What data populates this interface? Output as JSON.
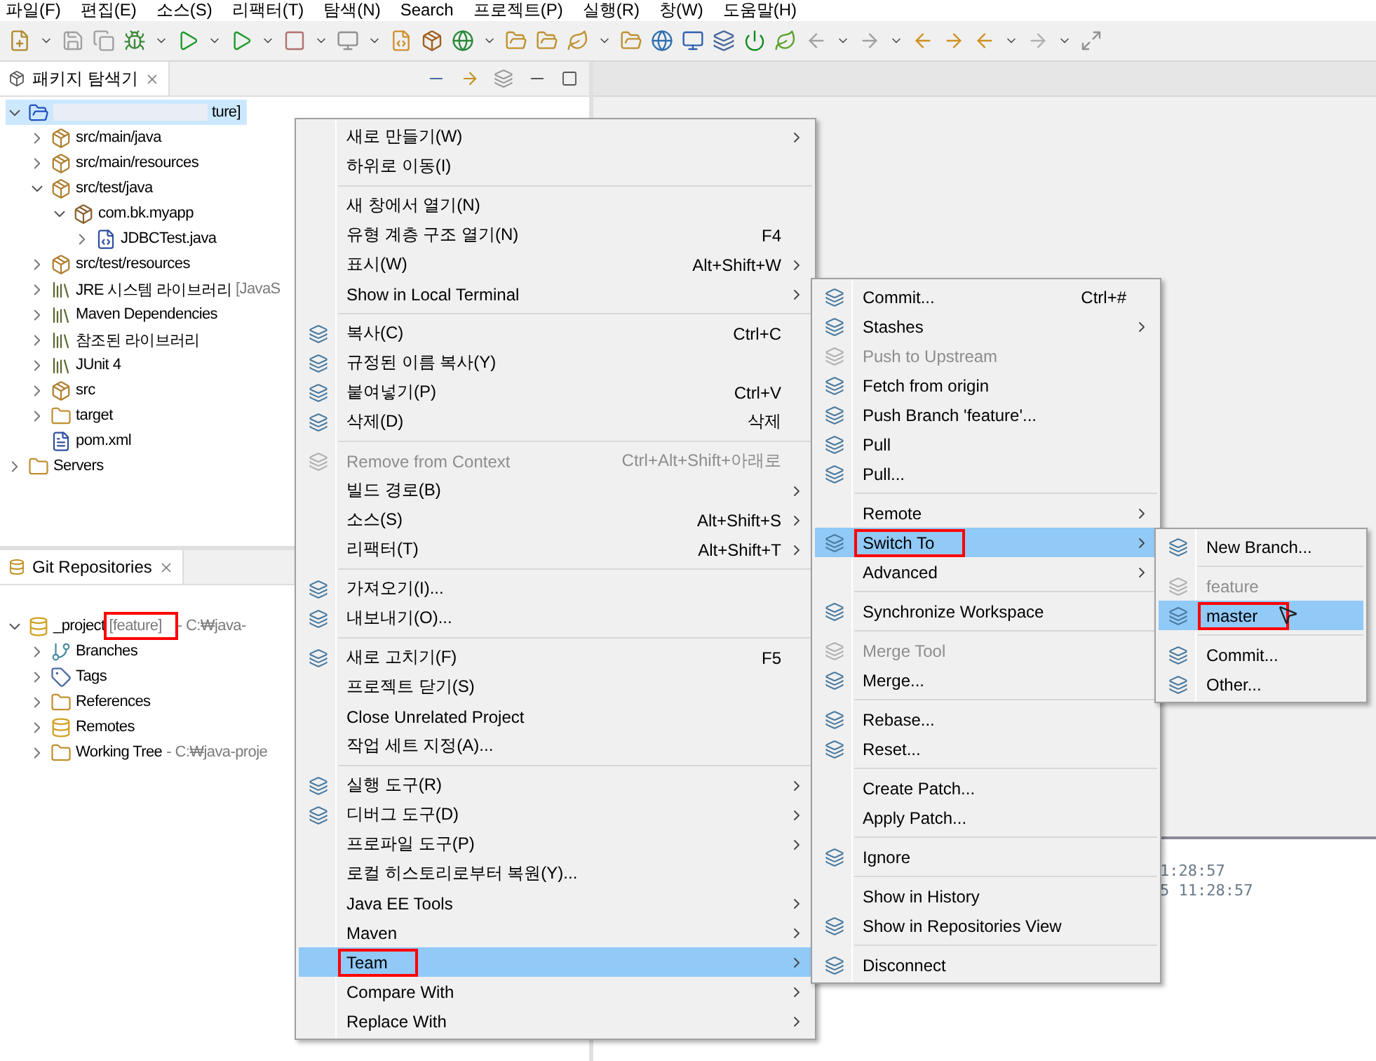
{
  "menu_bar": [
    "파일(F)",
    "편집(E)",
    "소스(S)",
    "리팩터(T)",
    "탐색(N)",
    "Search",
    "프로젝트(P)",
    "실행(R)",
    "창(W)",
    "도움말(H)"
  ],
  "package_explorer": {
    "title": "패키지 탐색기",
    "tree": [
      {
        "kind": "project",
        "label": "ture]",
        "redacted": true,
        "expanded": true,
        "selected": true,
        "children": [
          {
            "kind": "source-folder",
            "label": "src/main/java",
            "expanded": false,
            "selected": false
          },
          {
            "kind": "source-folder",
            "label": "src/main/resources",
            "expanded": false,
            "selected": false
          },
          {
            "kind": "source-folder",
            "label": "src/test/java",
            "expanded": true,
            "selected": false,
            "children": [
              {
                "kind": "package",
                "label": "com.bk.myapp",
                "expanded": true,
                "selected": false,
                "children": [
                  {
                    "kind": "java-file",
                    "label": "JDBCTest.java",
                    "expanded": false,
                    "selected": false
                  }
                ]
              }
            ]
          },
          {
            "kind": "source-folder",
            "label": "src/test/resources",
            "expanded": false,
            "selected": false
          },
          {
            "kind": "library",
            "label": "JRE 시스템 라이브러리",
            "decoration": "[JavaS",
            "expanded": false,
            "selected": false
          },
          {
            "kind": "library",
            "label": "Maven Dependencies",
            "expanded": false,
            "selected": false
          },
          {
            "kind": "library",
            "label": "참조된 라이브러리",
            "expanded": false,
            "selected": false
          },
          {
            "kind": "library",
            "label": "JUnit 4",
            "expanded": false,
            "selected": false
          },
          {
            "kind": "source-folder",
            "label": "src",
            "expanded": false,
            "selected": false
          },
          {
            "kind": "folder",
            "label": "target",
            "expanded": false,
            "selected": false
          },
          {
            "kind": "xml-file",
            "label": "pom.xml",
            "selected": false
          }
        ]
      },
      {
        "kind": "folder",
        "label": "Servers",
        "expanded": false,
        "selected": false
      }
    ]
  },
  "git_repositories": {
    "title": "Git Repositories",
    "tree": [
      {
        "kind": "repo",
        "label": "_project",
        "decoration": "[feature]",
        "decoration_annotated": true,
        "path": "- C:₩java-",
        "expanded": true,
        "selected": false,
        "children": [
          {
            "kind": "branches",
            "label": "Branches",
            "expanded": false,
            "selected": false
          },
          {
            "kind": "tags",
            "label": "Tags",
            "expanded": false,
            "selected": false
          },
          {
            "kind": "folder",
            "label": "References",
            "expanded": false,
            "selected": false
          },
          {
            "kind": "repo",
            "label": "Remotes",
            "expanded": false,
            "selected": false
          },
          {
            "kind": "folder",
            "label": "Working Tree",
            "path": "- C:₩java-proje",
            "expanded": false,
            "selected": false
          }
        ]
      }
    ]
  },
  "console": {
    "lines": [
      "1:28:57",
      "5 11:28:57"
    ]
  },
  "context_menu": [
    {
      "kind": "item",
      "label": "새로 만들기(W)",
      "submenu": true,
      "has_icon": false,
      "disabled": false,
      "selected": false,
      "annotated": false
    },
    {
      "kind": "item",
      "label": "하위로 이동(I)",
      "submenu": false,
      "has_icon": false,
      "disabled": false,
      "selected": false,
      "annotated": false
    },
    {
      "kind": "separator"
    },
    {
      "kind": "item",
      "label": "새 창에서 열기(N)",
      "submenu": false,
      "has_icon": false,
      "disabled": false,
      "selected": false,
      "annotated": false
    },
    {
      "kind": "item",
      "label": "유형 계층 구조 열기(N)",
      "shortcut": "F4",
      "submenu": false,
      "has_icon": false,
      "disabled": false,
      "selected": false,
      "annotated": false
    },
    {
      "kind": "item",
      "label": "표시(W)",
      "shortcut": "Alt+Shift+W",
      "submenu": true,
      "has_icon": false,
      "disabled": false,
      "selected": false,
      "annotated": false
    },
    {
      "kind": "item",
      "label": "Show in Local Terminal",
      "submenu": true,
      "has_icon": false,
      "disabled": false,
      "selected": false,
      "annotated": false
    },
    {
      "kind": "separator"
    },
    {
      "kind": "item",
      "label": "복사(C)",
      "shortcut": "Ctrl+C",
      "submenu": false,
      "has_icon": true,
      "disabled": false,
      "selected": false,
      "annotated": false
    },
    {
      "kind": "item",
      "label": "규정된 이름 복사(Y)",
      "submenu": false,
      "has_icon": true,
      "disabled": false,
      "selected": false,
      "annotated": false
    },
    {
      "kind": "item",
      "label": "붙여넣기(P)",
      "shortcut": "Ctrl+V",
      "submenu": false,
      "has_icon": true,
      "disabled": false,
      "selected": false,
      "annotated": false
    },
    {
      "kind": "item",
      "label": "삭제(D)",
      "shortcut": "삭제",
      "submenu": false,
      "has_icon": true,
      "disabled": false,
      "selected": false,
      "annotated": false
    },
    {
      "kind": "separator"
    },
    {
      "kind": "item",
      "label": "Remove from Context",
      "shortcut": "Ctrl+Alt+Shift+아래로",
      "submenu": false,
      "has_icon": true,
      "disabled": true,
      "selected": false,
      "annotated": false
    },
    {
      "kind": "item",
      "label": "빌드 경로(B)",
      "submenu": true,
      "has_icon": false,
      "disabled": false,
      "selected": false,
      "annotated": false
    },
    {
      "kind": "item",
      "label": "소스(S)",
      "shortcut": "Alt+Shift+S",
      "submenu": true,
      "has_icon": false,
      "disabled": false,
      "selected": false,
      "annotated": false
    },
    {
      "kind": "item",
      "label": "리팩터(T)",
      "shortcut": "Alt+Shift+T",
      "submenu": true,
      "has_icon": false,
      "disabled": false,
      "selected": false,
      "annotated": false
    },
    {
      "kind": "separator"
    },
    {
      "kind": "item",
      "label": "가져오기(I)...",
      "submenu": false,
      "has_icon": true,
      "disabled": false,
      "selected": false,
      "annotated": false
    },
    {
      "kind": "item",
      "label": "내보내기(O)...",
      "submenu": false,
      "has_icon": true,
      "disabled": false,
      "selected": false,
      "annotated": false
    },
    {
      "kind": "separator"
    },
    {
      "kind": "item",
      "label": "새로 고치기(F)",
      "shortcut": "F5",
      "submenu": false,
      "has_icon": true,
      "disabled": false,
      "selected": false,
      "annotated": false
    },
    {
      "kind": "item",
      "label": "프로젝트 닫기(S)",
      "submenu": false,
      "has_icon": false,
      "disabled": false,
      "selected": false,
      "annotated": false
    },
    {
      "kind": "item",
      "label": "Close Unrelated Project",
      "submenu": false,
      "has_icon": false,
      "disabled": false,
      "selected": false,
      "annotated": false
    },
    {
      "kind": "item",
      "label": "작업 세트 지정(A)...",
      "submenu": false,
      "has_icon": false,
      "disabled": false,
      "selected": false,
      "annotated": false
    },
    {
      "kind": "separator"
    },
    {
      "kind": "item",
      "label": "실행 도구(R)",
      "submenu": true,
      "has_icon": true,
      "disabled": false,
      "selected": false,
      "annotated": false
    },
    {
      "kind": "item",
      "label": "디버그 도구(D)",
      "submenu": true,
      "has_icon": true,
      "disabled": false,
      "selected": false,
      "annotated": false
    },
    {
      "kind": "item",
      "label": "프로파일 도구(P)",
      "submenu": true,
      "has_icon": false,
      "disabled": false,
      "selected": false,
      "annotated": false
    },
    {
      "kind": "item",
      "label": "로컬 히스토리로부터 복원(Y)...",
      "submenu": false,
      "has_icon": false,
      "disabled": false,
      "selected": false,
      "annotated": false
    },
    {
      "kind": "item",
      "label": "Java EE Tools",
      "submenu": true,
      "has_icon": false,
      "disabled": false,
      "selected": false,
      "annotated": false
    },
    {
      "kind": "item",
      "label": "Maven",
      "submenu": true,
      "has_icon": false,
      "disabled": false,
      "selected": false,
      "annotated": false
    },
    {
      "kind": "item",
      "label": "Team",
      "submenu": true,
      "has_icon": false,
      "disabled": false,
      "selected": true,
      "annotated": true
    },
    {
      "kind": "item",
      "label": "Compare With",
      "submenu": true,
      "has_icon": false,
      "disabled": false,
      "selected": false,
      "annotated": false
    },
    {
      "kind": "item",
      "label": "Replace With",
      "submenu": true,
      "has_icon": false,
      "disabled": false,
      "selected": false,
      "annotated": false
    }
  ],
  "team_menu": [
    {
      "kind": "item",
      "label": "Commit...",
      "shortcut": "Ctrl+#",
      "submenu": false,
      "has_icon": true,
      "disabled": false,
      "selected": false,
      "annotated": false
    },
    {
      "kind": "item",
      "label": "Stashes",
      "submenu": true,
      "has_icon": true,
      "disabled": false,
      "selected": false,
      "annotated": false
    },
    {
      "kind": "item",
      "label": "Push to Upstream",
      "submenu": false,
      "has_icon": true,
      "disabled": true,
      "selected": false,
      "annotated": false
    },
    {
      "kind": "item",
      "label": "Fetch from origin",
      "submenu": false,
      "has_icon": true,
      "disabled": false,
      "selected": false,
      "annotated": false
    },
    {
      "kind": "item",
      "label": "Push Branch 'feature'...",
      "submenu": false,
      "has_icon": true,
      "disabled": false,
      "selected": false,
      "annotated": false
    },
    {
      "kind": "item",
      "label": "Pull",
      "submenu": false,
      "has_icon": true,
      "disabled": false,
      "selected": false,
      "annotated": false
    },
    {
      "kind": "item",
      "label": "Pull...",
      "submenu": false,
      "has_icon": true,
      "disabled": false,
      "selected": false,
      "annotated": false
    },
    {
      "kind": "separator"
    },
    {
      "kind": "item",
      "label": "Remote",
      "submenu": true,
      "has_icon": false,
      "disabled": false,
      "selected": false,
      "annotated": false
    },
    {
      "kind": "item",
      "label": "Switch To",
      "submenu": true,
      "has_icon": true,
      "disabled": false,
      "selected": true,
      "annotated": true
    },
    {
      "kind": "item",
      "label": "Advanced",
      "submenu": true,
      "has_icon": false,
      "disabled": false,
      "selected": false,
      "annotated": false
    },
    {
      "kind": "separator"
    },
    {
      "kind": "item",
      "label": "Synchronize Workspace",
      "submenu": false,
      "has_icon": true,
      "disabled": false,
      "selected": false,
      "annotated": false
    },
    {
      "kind": "separator"
    },
    {
      "kind": "item",
      "label": "Merge Tool",
      "submenu": false,
      "has_icon": true,
      "disabled": true,
      "selected": false,
      "annotated": false
    },
    {
      "kind": "item",
      "label": "Merge...",
      "submenu": false,
      "has_icon": true,
      "disabled": false,
      "selected": false,
      "annotated": false
    },
    {
      "kind": "separator"
    },
    {
      "kind": "item",
      "label": "Rebase...",
      "submenu": false,
      "has_icon": true,
      "disabled": false,
      "selected": false,
      "annotated": false
    },
    {
      "kind": "item",
      "label": "Reset...",
      "submenu": false,
      "has_icon": true,
      "disabled": false,
      "selected": false,
      "annotated": false
    },
    {
      "kind": "separator"
    },
    {
      "kind": "item",
      "label": "Create Patch...",
      "submenu": false,
      "has_icon": false,
      "disabled": false,
      "selected": false,
      "annotated": false
    },
    {
      "kind": "item",
      "label": "Apply Patch...",
      "submenu": false,
      "has_icon": false,
      "disabled": false,
      "selected": false,
      "annotated": false
    },
    {
      "kind": "separator"
    },
    {
      "kind": "item",
      "label": "Ignore",
      "submenu": false,
      "has_icon": true,
      "disabled": false,
      "selected": false,
      "annotated": false
    },
    {
      "kind": "separator"
    },
    {
      "kind": "item",
      "label": "Show in History",
      "submenu": false,
      "has_icon": false,
      "disabled": false,
      "selected": false,
      "annotated": false
    },
    {
      "kind": "item",
      "label": "Show in Repositories View",
      "submenu": false,
      "has_icon": true,
      "disabled": false,
      "selected": false,
      "annotated": false
    },
    {
      "kind": "separator"
    },
    {
      "kind": "item",
      "label": "Disconnect",
      "submenu": false,
      "has_icon": true,
      "disabled": false,
      "selected": false,
      "annotated": false
    }
  ],
  "switch_menu": [
    {
      "kind": "item",
      "label": "New Branch...",
      "submenu": false,
      "has_icon": true,
      "disabled": false,
      "selected": false,
      "annotated": false
    },
    {
      "kind": "separator"
    },
    {
      "kind": "item",
      "label": "feature",
      "submenu": false,
      "has_icon": true,
      "disabled": true,
      "selected": false,
      "annotated": false
    },
    {
      "kind": "item",
      "label": "master",
      "submenu": false,
      "has_icon": true,
      "disabled": false,
      "selected": true,
      "annotated": true
    },
    {
      "kind": "separator"
    },
    {
      "kind": "item",
      "label": "Commit...",
      "submenu": false,
      "has_icon": true,
      "disabled": false,
      "selected": false,
      "annotated": false
    },
    {
      "kind": "item",
      "label": "Other...",
      "submenu": false,
      "has_icon": true,
      "disabled": false,
      "selected": false,
      "annotated": false
    }
  ]
}
